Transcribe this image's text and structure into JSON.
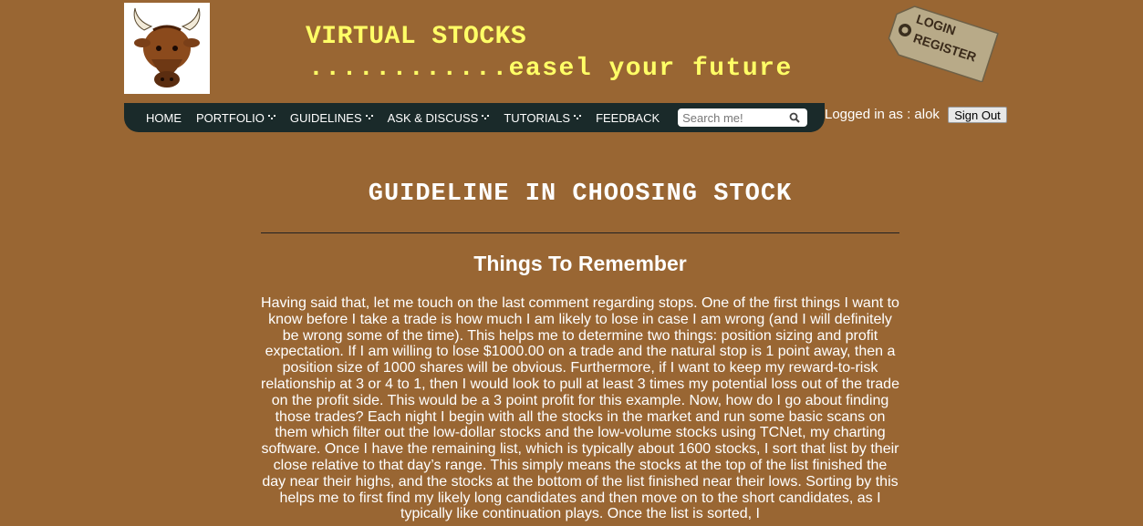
{
  "header": {
    "site_title": "VIRTUAL STOCKS",
    "tagline": "............easel your future",
    "login_tag": {
      "line1": "LOGIN",
      "line2": "REGISTER"
    }
  },
  "nav": {
    "items": [
      {
        "label": "HOME",
        "has_dropdown": false
      },
      {
        "label": "PORTFOLIO",
        "has_dropdown": true
      },
      {
        "label": "GUIDELINES",
        "has_dropdown": true
      },
      {
        "label": "ASK & DISCUSS",
        "has_dropdown": true
      },
      {
        "label": "TUTORIALS",
        "has_dropdown": true
      },
      {
        "label": "FEEDBACK",
        "has_dropdown": false
      }
    ],
    "search_placeholder": "Search me!"
  },
  "user": {
    "logged_in_text": "Logged in as : alok",
    "sign_out_label": "Sign Out"
  },
  "main": {
    "title": "GUIDELINE IN CHOOSING STOCK",
    "heading": "Things To Remember",
    "paragraph": "Having said that, let me touch on the last comment regarding stops. One of the first things I want to know before I take a trade is how much I am likely to lose in case I am wrong (and I will definitely be wrong some of the time). This helps me to determine two things: position sizing and profit expectation. If I am willing to lose $1000.00 on a trade and the natural stop is 1 point away, then a position size of 1000 shares will be obvious. Furthermore, if I want to keep my reward-to-risk relationship at 3 or 4 to 1, then I would look to pull at least 3 times my potential loss out of the trade on the profit side. This would be a 3 point profit for this example. Now, how do I go about finding those trades? Each night I begin with all the stocks in the market and run some basic scans on them which filter out the low-dollar stocks and the low-volume stocks using TCNet, my charting software. Once I have the remaining list, which is typically about 1600 stocks, I sort that list by their close relative to that day’s range. This simply means the stocks at the top of the list finished the day near their highs, and the stocks at the bottom of the list finished near their lows. Sorting by this helps me to first find my likely long candidates and then move on to the short candidates, as I typically like continuation plays. Once the list is sorted, I"
  },
  "colors": {
    "background": "#996633",
    "navbar": "#1a2a2a",
    "title_yellow": "#ffff66",
    "text": "#ffffff"
  },
  "icons": {
    "logo": "bull-head-icon",
    "login_tag": "paper-tag-icon",
    "search": "search-icon",
    "dropdown": "dots-arrow-icon"
  }
}
